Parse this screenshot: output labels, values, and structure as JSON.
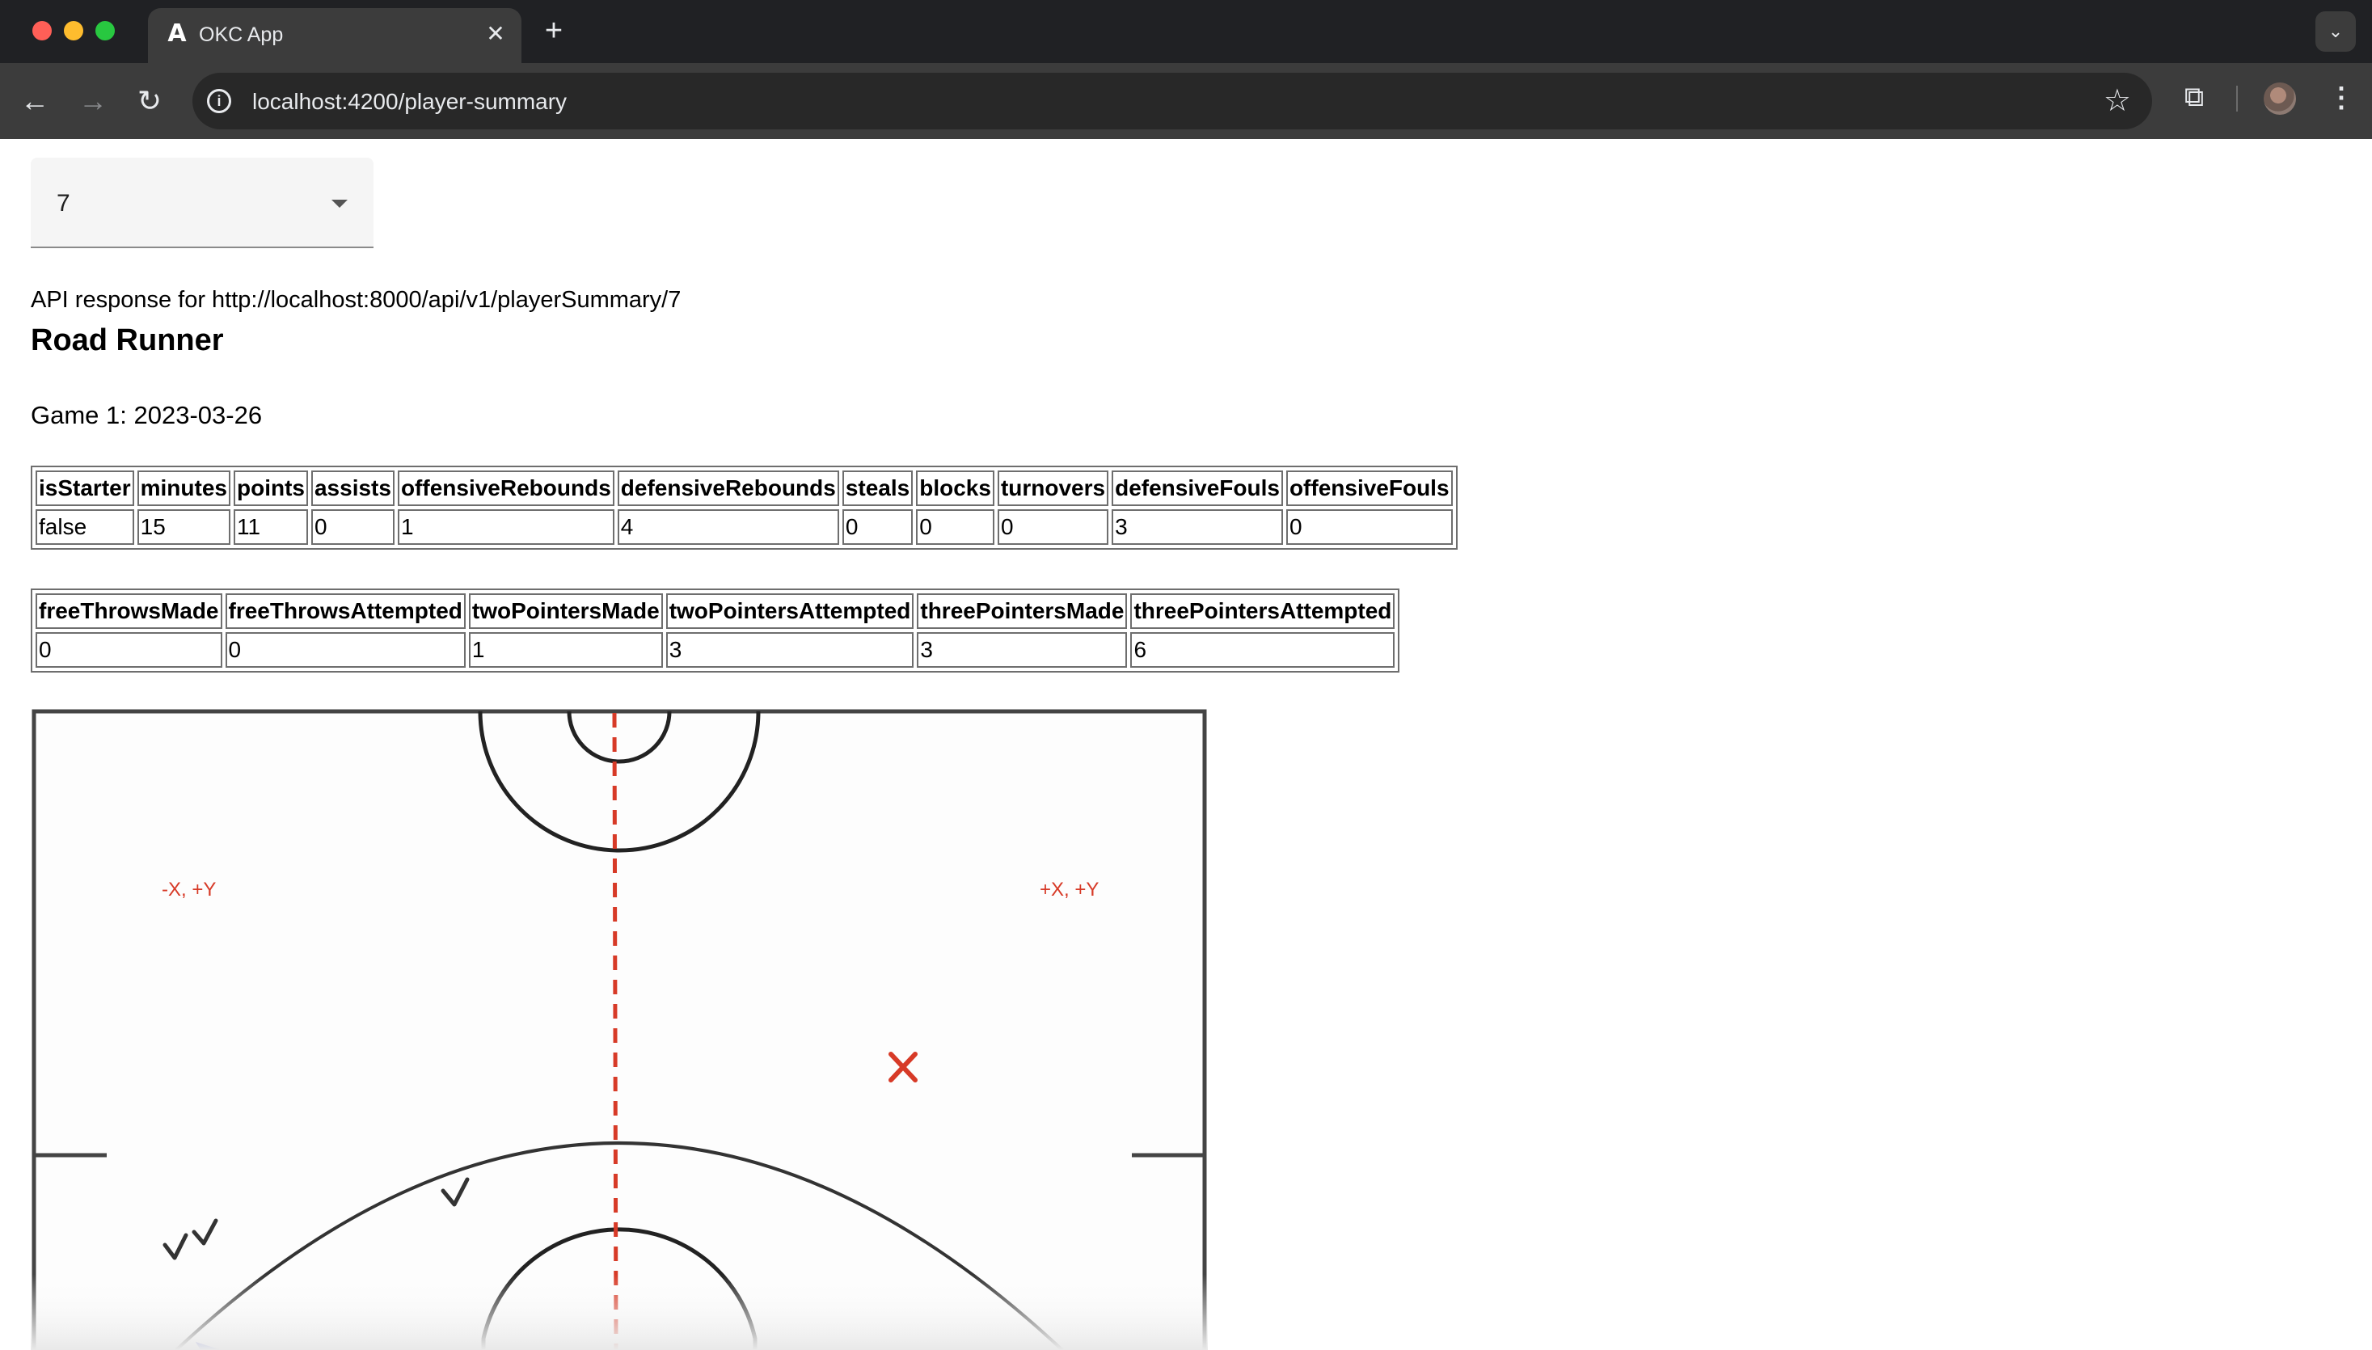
{
  "browser": {
    "tab_title": "OKC App",
    "tab_favicon": "A",
    "url": "localhost:4200/player-summary",
    "icons": [
      "close-icon",
      "plus-icon",
      "chevron-down-icon",
      "back-arrow-icon",
      "forward-arrow-icon",
      "reload-icon",
      "info-icon",
      "star-icon",
      "extensions-icon",
      "avatar",
      "more-vert-icon"
    ]
  },
  "page": {
    "player_select": {
      "value": "7"
    },
    "api_line": "API response for http://localhost:8000/api/v1/playerSummary/7",
    "player_name": "Road Runner",
    "game_line": "Game 1: 2023-03-26",
    "stats_table_1": {
      "headers": [
        "isStarter",
        "minutes",
        "points",
        "assists",
        "offensiveRebounds",
        "defensiveRebounds",
        "steals",
        "blocks",
        "turnovers",
        "defensiveFouls",
        "offensiveFouls"
      ],
      "values": [
        "false",
        "15",
        "11",
        "0",
        "1",
        "4",
        "0",
        "0",
        "0",
        "3",
        "0"
      ]
    },
    "stats_table_2": {
      "headers": [
        "freeThrowsMade",
        "freeThrowsAttempted",
        "twoPointersMade",
        "twoPointersAttempted",
        "threePointersMade",
        "threePointersAttempted"
      ],
      "values": [
        "0",
        "0",
        "1",
        "3",
        "3",
        "6"
      ]
    },
    "court": {
      "quadrant_left_label": "-X, +Y",
      "quadrant_right_label": "+X, +Y",
      "label_color": "#d73a27",
      "centerline_color": "#d73a27",
      "miss_color": "#d73a27",
      "make_color": "#333333",
      "markers": [
        "miss-x-marker",
        "make-check-marker",
        "make-check-marker",
        "make-check-marker"
      ]
    }
  }
}
